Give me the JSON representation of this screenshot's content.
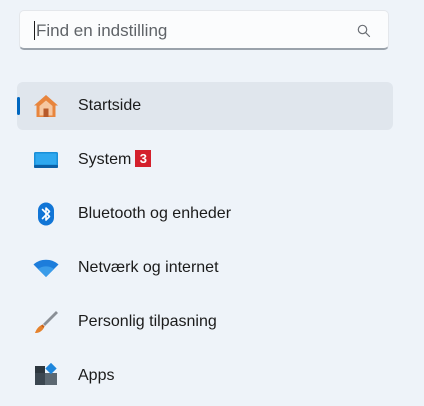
{
  "search": {
    "placeholder": "Find en indstilling"
  },
  "nav": {
    "items": [
      {
        "label": "Startside",
        "icon": "home-icon",
        "selected": true
      },
      {
        "label": "System",
        "icon": "system-display-icon",
        "badge": "3"
      },
      {
        "label": "Bluetooth og enheder",
        "icon": "bluetooth-icon"
      },
      {
        "label": "Netværk og internet",
        "icon": "wifi-icon"
      },
      {
        "label": "Personlig tilpasning",
        "icon": "brush-icon"
      },
      {
        "label": "Apps",
        "icon": "apps-icon"
      }
    ]
  },
  "colors": {
    "background": "#eef3f9",
    "selected_background": "#e0e6ed",
    "accent": "#0067c0",
    "badge": "#d4202c"
  }
}
